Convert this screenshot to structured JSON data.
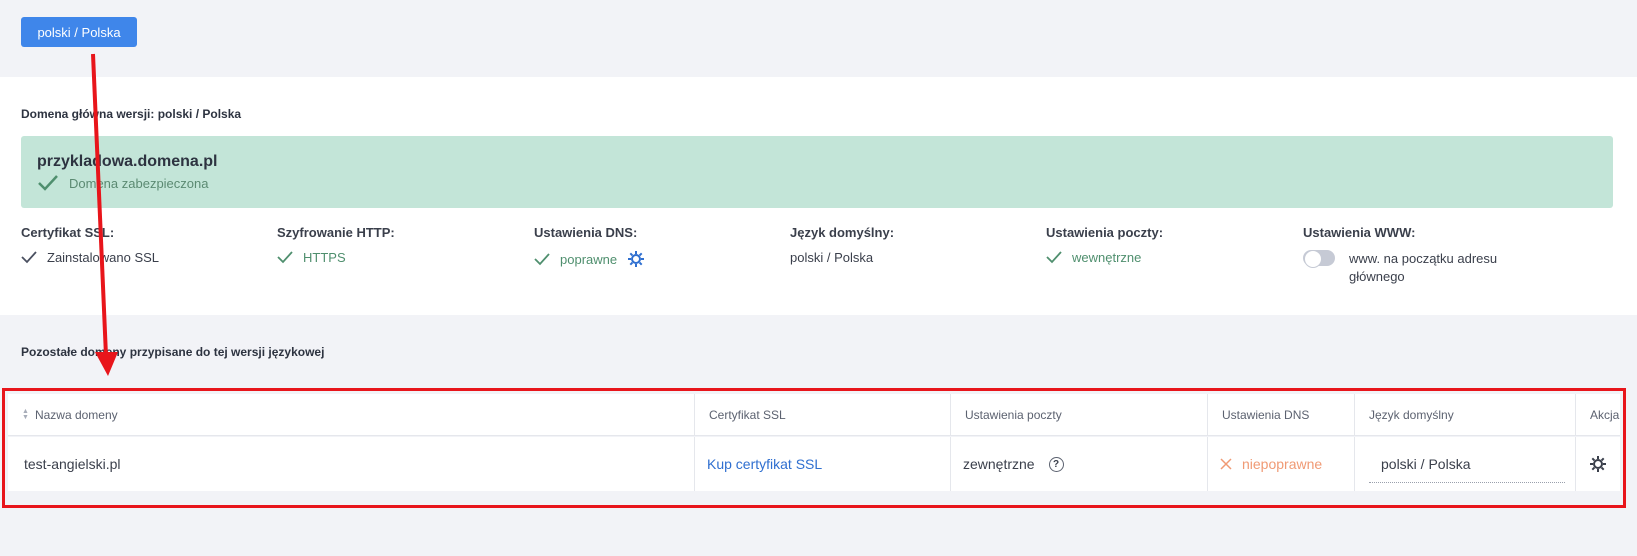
{
  "language_button": "polski / Polska",
  "main_domain": {
    "section_title": "Domena główna wersji: polski / Polska",
    "name": "przykladowa.domena.pl",
    "status": "Domena zabezpieczona"
  },
  "properties": [
    {
      "label": "Certyfikat SSL:",
      "value": "Zainstalowano SSL",
      "icon": "check-icon"
    },
    {
      "label": "Szyfrowanie HTTP:",
      "value": "HTTPS",
      "icon": "check-icon"
    },
    {
      "label": "Ustawienia DNS:",
      "value": "poprawne",
      "icon": "check-icon"
    },
    {
      "label": "Język domyślny:",
      "value": "polski / Polska"
    },
    {
      "label": "Ustawienia poczty:",
      "value": "wewnętrzne",
      "icon": "check-icon"
    },
    {
      "label": "Ustawienia WWW:",
      "value": "www. na początku adresu głównego",
      "toggle": false
    }
  ],
  "other_domains": {
    "section_title": "Pozostałe domeny przypisane do tej wersji językowej",
    "columns": [
      "Nazwa domeny",
      "Certyfikat SSL",
      "Ustawienia poczty",
      "Ustawienia DNS",
      "Język domyślny",
      "Akcja"
    ],
    "rows": [
      {
        "domain": "test-angielski.pl",
        "ssl": "Kup certyfikat SSL",
        "mail": "zewnętrzne",
        "dns": "niepoprawne",
        "language": "polski / Polska"
      }
    ]
  },
  "colors": {
    "primary": "#3f86ea",
    "success_bg": "#c3e5d8",
    "success": "#4f8f6e",
    "error": "#f09a74",
    "annotation": "#e8151b"
  }
}
